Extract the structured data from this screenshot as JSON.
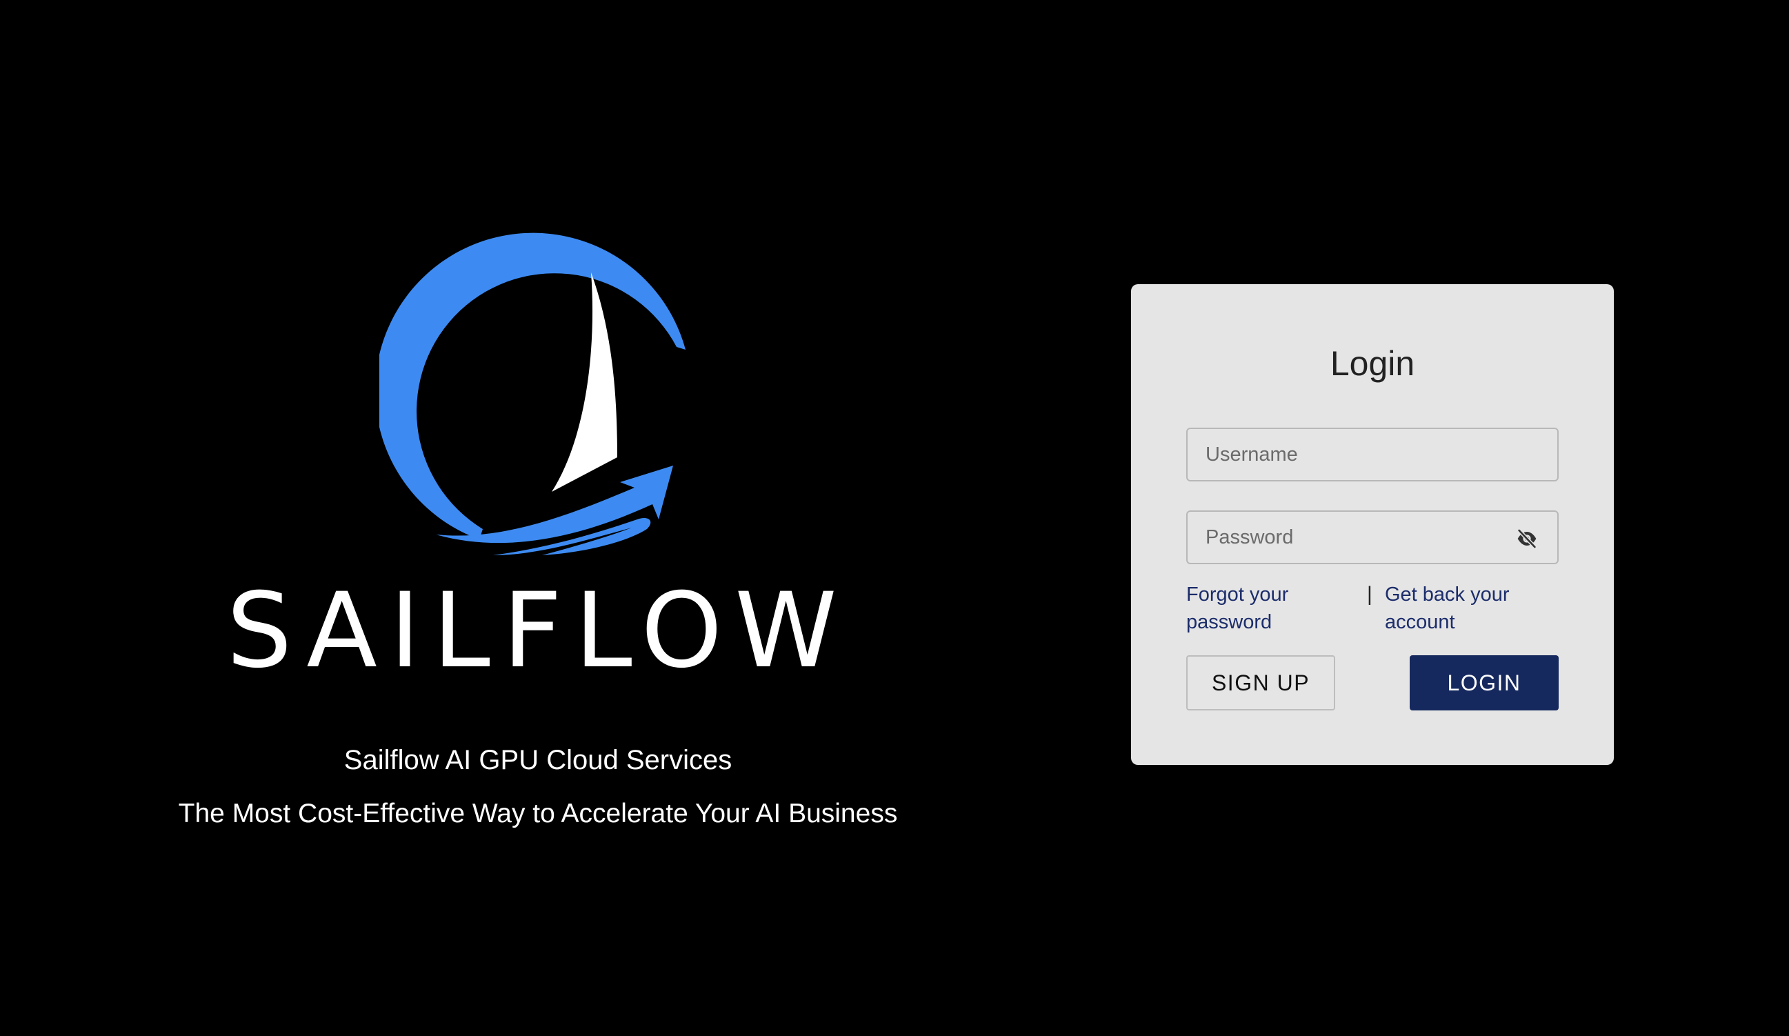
{
  "brand": {
    "logo_icon": "sailboat-circle-logo",
    "wordmark": "SAILFLOW",
    "tagline_primary": "Sailflow AI GPU Cloud Services",
    "tagline_secondary": "The Most Cost-Effective Way to Accelerate Your AI Business",
    "accent_color": "#3d8bf2"
  },
  "login": {
    "title": "Login",
    "username_placeholder": "Username",
    "username_value": "",
    "password_placeholder": "Password",
    "password_value": "",
    "password_toggle_icon": "eye-off-icon",
    "forgot_password_label": "Forgot your password",
    "separator": "|",
    "recover_account_label": "Get back your account",
    "signup_label": "SIGN UP",
    "login_label": "LOGIN",
    "primary_color": "#16295e",
    "link_color": "#1c2d6b",
    "card_color": "#e5e5e5"
  }
}
